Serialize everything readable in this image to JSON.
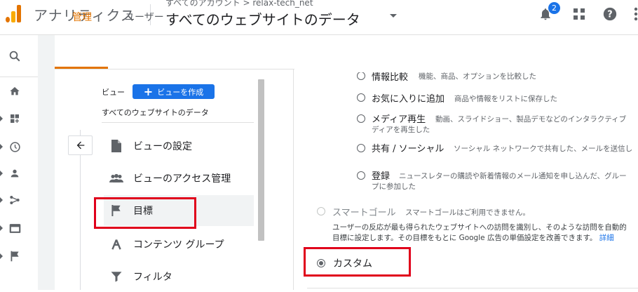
{
  "header": {
    "app_title": "アナリティクス",
    "breadcrumb": "すべてのアカウント > relax-tech_net",
    "property_title": "すべてのウェブサイトのデータ",
    "notification_count": "2",
    "logo_colors": [
      "#f9ab00",
      "#e37400"
    ]
  },
  "tabs": [
    {
      "label": "管理",
      "active": true
    },
    {
      "label": "ユーザー",
      "active": false
    }
  ],
  "left_panel": {
    "view_label": "ビュー",
    "create_view_button": "ビューを作成",
    "view_name": "すべてのウェブサイトのデータ",
    "menu": [
      {
        "label": "ビューの設定",
        "icon": "document-icon"
      },
      {
        "label": "ビューのアクセス管理",
        "icon": "people-icon"
      },
      {
        "label": "目標",
        "icon": "flag-icon",
        "highlighted": true
      },
      {
        "label": "コンテンツ グループ",
        "icon": "content-group-icon"
      },
      {
        "label": "フィルタ",
        "icon": "filter-icon"
      }
    ]
  },
  "right_panel": {
    "options": [
      {
        "title": "情報比較",
        "desc": "機能、商品、オプションを比較した"
      },
      {
        "title": "お気に入りに追加",
        "desc": "商品や情報をリストに保存した"
      },
      {
        "title": "メディア再生",
        "desc": "動画、スライドショー、製品デモなどのインタラクティブ",
        "desc2": "ディアを再生した"
      },
      {
        "title": "共有 / ソーシャル",
        "desc": "ソーシャル ネットワークで共有した、メールを送信し"
      },
      {
        "title": "登録",
        "desc": "ニュースレターの購読や新着情報のメール通知を申し込んだ、グルー",
        "desc2": "プに参加した"
      }
    ],
    "smart_goal": {
      "title": "スマートゴール",
      "desc": "スマートゴールはご利用できません。",
      "info_line1": "ユーザーの反応が最も得られたウェブサイトへの訪問を識別し、そのような訪問を自動的",
      "info_line2": "目標に設定します。その目標をもとに Google 広告の単価設定を改善できます。",
      "link": "詳細"
    },
    "custom": {
      "label": "カスタム",
      "selected": true
    }
  },
  "colors": {
    "accent_orange": "#e37400",
    "primary_blue": "#1a73e8",
    "highlight_red": "#e0001b"
  }
}
